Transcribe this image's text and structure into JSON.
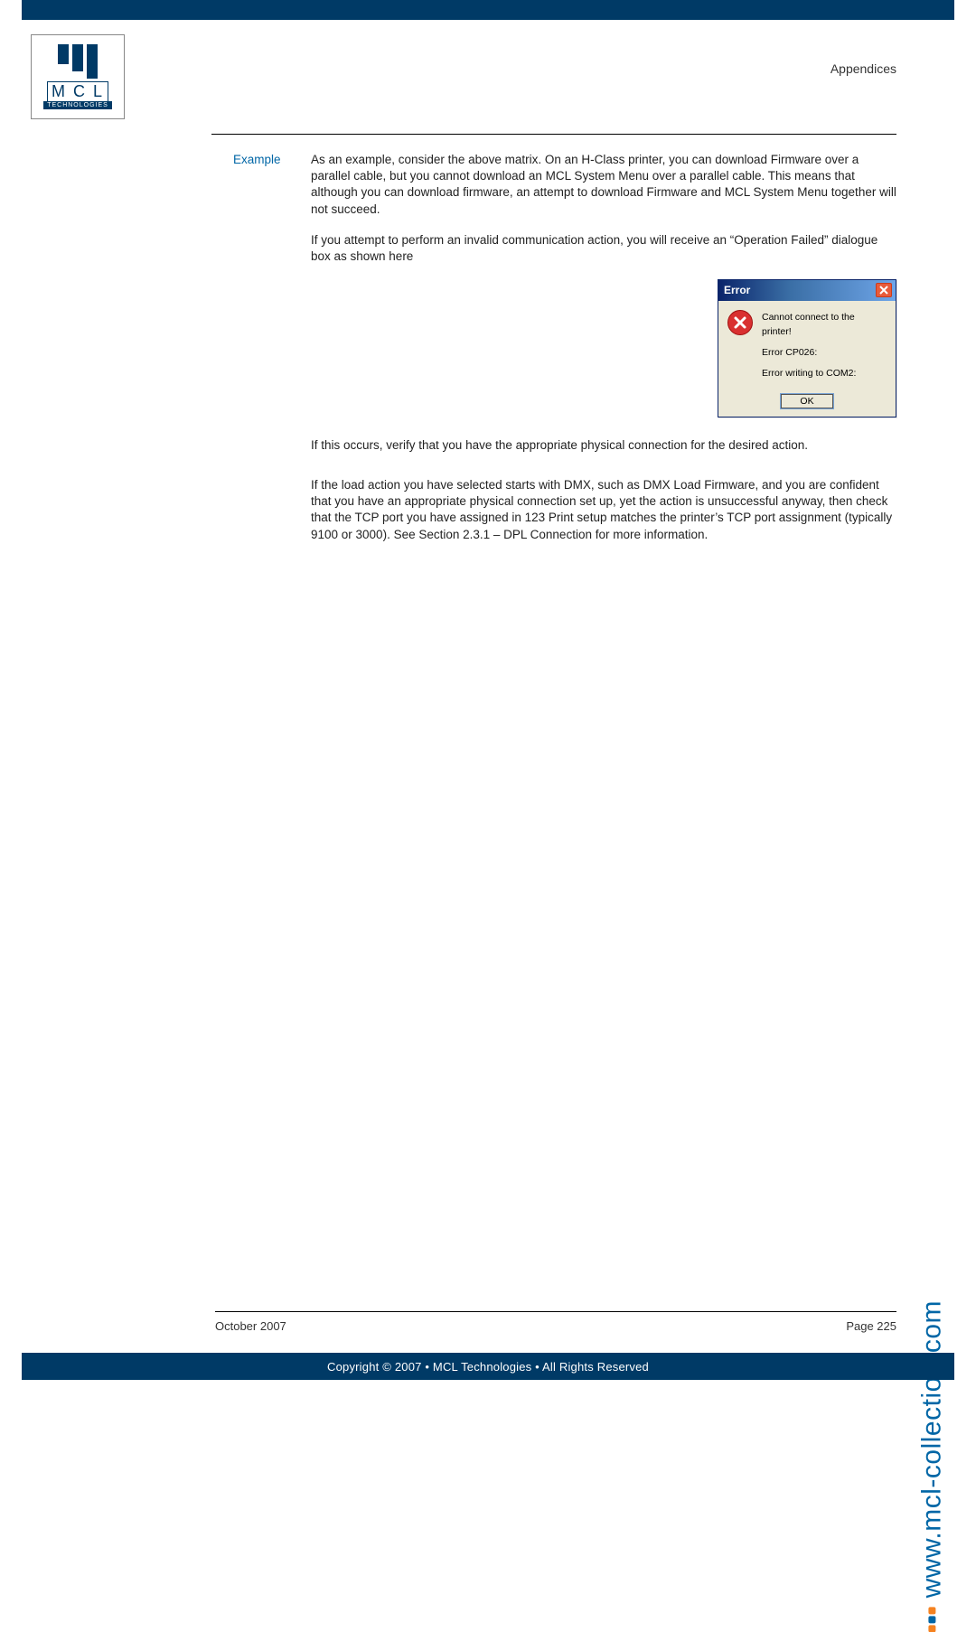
{
  "header": {
    "section": "Appendices"
  },
  "logo": {
    "letters": "M C L",
    "sub": "TECHNOLOGIES"
  },
  "label": "Example",
  "paragraphs": {
    "p1": "As an example, consider the above matrix. On an H-Class printer, you can download Firmware over a parallel cable, but you cannot download an MCL System Menu over a parallel cable. This means that although you can download firmware, an attempt to download Firmware and MCL System Menu together will not succeed.",
    "p2": "If you attempt to perform an invalid communication action, you will receive an “Operation Failed” dialogue box as shown here",
    "p3": "If this occurs, verify that you have the appropriate physical connection for the desired action.",
    "p4": "If the load action you have selected starts with DMX, such as DMX Load Firmware, and you are confident that you have an appropriate physical connection set up, yet the action is unsuccessful anyway, then check that the TCP port you have assigned in 123 Print setup matches the printer’s TCP port assignment (typically 9100 or 3000). See Section 2.3.1 – DPL Connection for more information."
  },
  "dialog": {
    "title": "Error",
    "msg1": "Cannot connect to the printer!",
    "msg2": "Error CP026:",
    "msg3": "Error writing to COM2:",
    "ok": "OK"
  },
  "side_url": "www.mcl-collection.com",
  "footer": {
    "date": "October 2007",
    "page": "Page  225",
    "copyright": "Copyright © 2007 • MCL Technologies • All Rights Reserved"
  }
}
